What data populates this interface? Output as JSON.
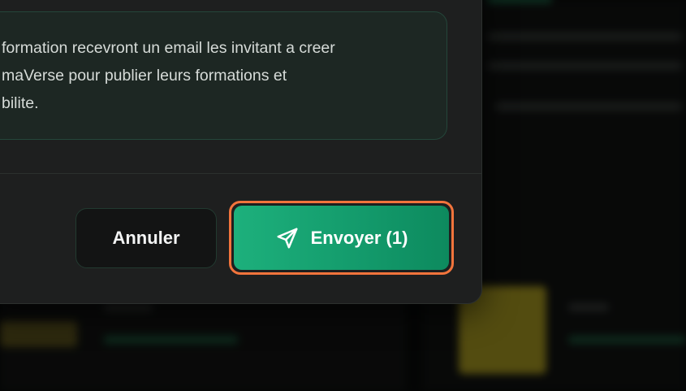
{
  "dialog": {
    "info_text": "formation recevront un email les invitant a creer\nmaVerse pour publier leurs formations et\nbilite.",
    "cancel_label": "Annuler",
    "send_label": "Envoyer (1)",
    "send_icon": "send-icon"
  },
  "colors": {
    "accent": "#139a6b",
    "focus_ring": "#f2743c",
    "modal_bg": "#1e1f1f",
    "info_bg": "#1d2723"
  }
}
